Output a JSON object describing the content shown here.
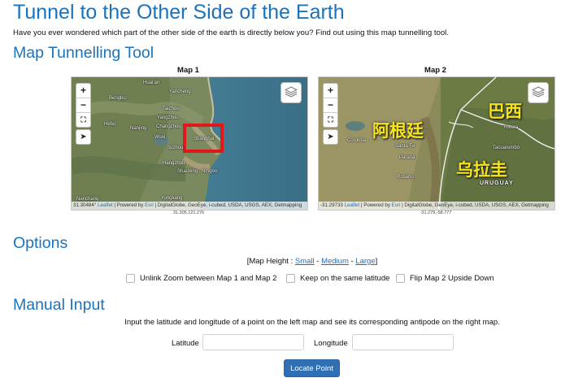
{
  "header": {
    "title": "Tunnel to the Other Side of the Earth",
    "lead": "Have you ever wondered which part of the other side of the earth is directly below you? Find out using this map tunnelling tool."
  },
  "tool": {
    "heading": "Map Tunnelling Tool"
  },
  "map1": {
    "title": "Map 1",
    "zoom_in": "+",
    "zoom_out": "−",
    "fullscreen": "⛶",
    "locate": "➤",
    "attribution_coord": "31.30484°",
    "attribution_leaflet": "Leaflet",
    "attribution_powered": "| Powered by",
    "attribution_esri": "Esri",
    "attribution_sources": "| DigitalGlobe, GeoEye, i-cubed, USDA, USGS, AEX, Getmapping",
    "center_coord": "31.305,121.276",
    "places": [
      "Yancheng",
      "Huai'an",
      "Bengbu",
      "Taizhou",
      "Yangzhou",
      "Hefei",
      "Nanjing",
      "Changzhou",
      "Wuxi",
      "Suzhou",
      "Shanghai",
      "Hangzhou",
      "Shaoxing",
      "Ningbo",
      "Nanchang",
      "Yongkang"
    ]
  },
  "map2": {
    "title": "Map 2",
    "zoom_in": "+",
    "zoom_out": "−",
    "fullscreen": "⛶",
    "locate": "➤",
    "attribution_coord": "-31.29733",
    "attribution_leaflet": "Leaflet",
    "attribution_powered": "| Powered by",
    "attribution_esri": "Esri",
    "attribution_sources": "| DigitalGlobe, GeoEye, i-cubed, USDA, USGS, AEX, Getmapping",
    "center_coord": "-31.279,-58.777",
    "country_labels": [
      "阿根廷",
      "巴西",
      "乌拉圭"
    ],
    "country_label_en": "URUGUAY",
    "places": [
      "Córdoba",
      "Santa Fe",
      "Paraná",
      "Rosario",
      "Rivera",
      "Tacuarembó"
    ]
  },
  "options": {
    "heading": "Options",
    "map_height_prefix": "[Map Height :",
    "small": "Small",
    "sep1": "-",
    "medium": "Medium",
    "sep2": "-",
    "large": "Large",
    "suffix": "]",
    "checkboxes": [
      "Unlink Zoom between Map 1 and Map 2",
      "Keep on the same latitude",
      "Flip Map 2 Upside Down"
    ]
  },
  "manual": {
    "heading": "Manual Input",
    "description": "Input the latitude and longitude of a point on the left map and see its corresponding antipode on the right map.",
    "latitude_label": "Latitude",
    "latitude_value": "",
    "longitude_label": "Longitude",
    "longitude_value": "",
    "button": "Locate Point"
  }
}
